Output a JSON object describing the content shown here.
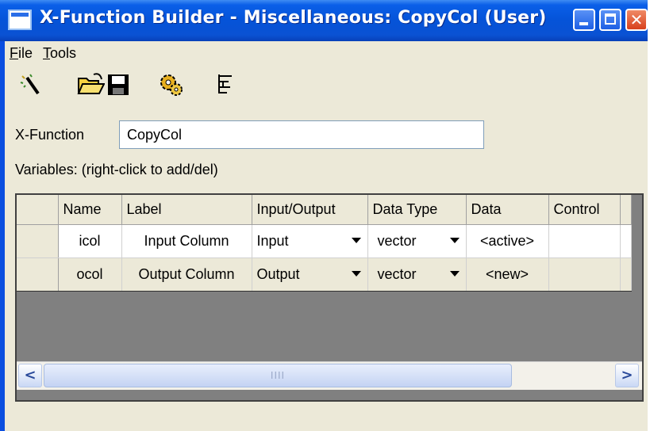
{
  "window": {
    "title": "X-Function Builder - Miscellaneous: CopyCol (User)",
    "close_glyph": "✕"
  },
  "menu": {
    "file": "File",
    "tools": "Tools"
  },
  "toolbar": {
    "icons": [
      "new-wizard-icon",
      "open-folder-icon",
      "save-disk-icon",
      "gears-icon",
      "tree-view-icon"
    ]
  },
  "xfunction": {
    "label": "X-Function",
    "value": "CopyCol"
  },
  "variables_label": "Variables: (right-click to add/del)",
  "grid": {
    "columns": [
      "Name",
      "Label",
      "Input/Output",
      "Data Type",
      "Data",
      "Control"
    ],
    "rows": [
      {
        "name": "icol",
        "label": "Input Column",
        "io": "Input",
        "type": "vector",
        "data": "<active>",
        "control": ""
      },
      {
        "name": "ocol",
        "label": "Output Column",
        "io": "Output",
        "type": "vector",
        "data": "<new>",
        "control": ""
      }
    ],
    "scroll_left": "<",
    "scroll_right": ">",
    "thumb_grip": "IIII"
  },
  "colors": {
    "titlebar": "#0553d8",
    "client": "#ece9d8",
    "grid_empty": "#808080"
  }
}
